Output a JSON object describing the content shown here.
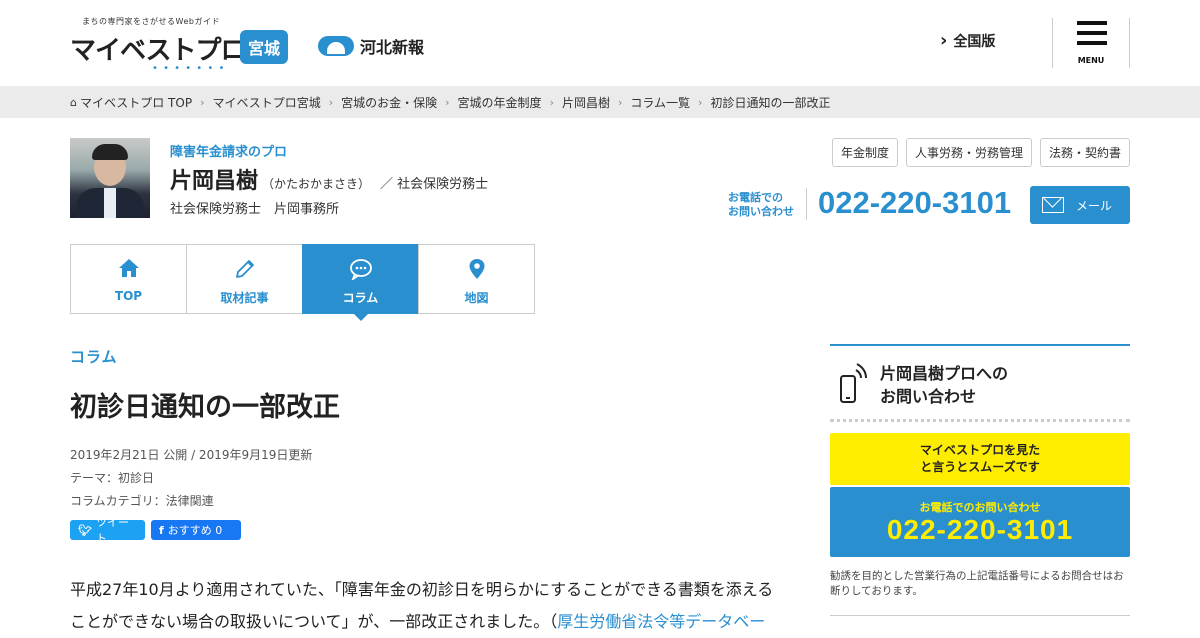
{
  "header": {
    "tagline": "まちの専門家をさがせるWebガイド",
    "brand": "マイベストプロ",
    "brand_dots": "• • • • • • •",
    "region": "宮城",
    "partner": "河北新報",
    "nationwide": "全国版",
    "menu_label": "MENU"
  },
  "breadcrumb": [
    "マイベストプロ TOP",
    "マイベストプロ宮城",
    "宮城のお金・保険",
    "宮城の年金制度",
    "片岡昌樹",
    "コラム一覧",
    "初診日通知の一部改正"
  ],
  "profile": {
    "tag": "障害年金請求のプロ",
    "name": "片岡昌樹",
    "kana": "（かたおかまさき）",
    "role": "／ 社会保険労務士",
    "office": "社会保険労務士　片岡事務所",
    "categories": [
      "年金制度",
      "人事労務・労務管理",
      "法務・契約書"
    ],
    "phone_label_1": "お電話での",
    "phone_label_2": "お問い合わせ",
    "phone": "022-220-3101",
    "mail_label": "メール"
  },
  "tabs": [
    {
      "label": "TOP",
      "icon": "home-icon",
      "active": false
    },
    {
      "label": "取材記事",
      "icon": "pencil-icon",
      "active": false
    },
    {
      "label": "コラム",
      "icon": "chat-icon",
      "active": true
    },
    {
      "label": "地図",
      "icon": "map-pin-icon",
      "active": false
    }
  ],
  "article": {
    "section": "コラム",
    "title": "初診日通知の一部改正",
    "dates": "2019年2月21日 公開 / 2019年9月19日更新",
    "theme": "テーマ：初診日",
    "category": "コラムカテゴリ：法律関連",
    "tweet_label": "ツイート",
    "fb_label": "おすすめ 0",
    "body_1": "平成27年10月より適用されていた、「障害年金の初診日を明らかにすることができる書類を添える",
    "body_2": "ことができない場合の取扱いについて」が、一部改正されました。（",
    "body_link": "厚生労働省法令等データベー"
  },
  "sidebar": {
    "title_1": "片岡昌樹プロへの",
    "title_2": "お問い合わせ",
    "yellow_1": "マイベストプロを見た",
    "yellow_2": "と言うとスムーズです",
    "blue_sub": "お電話でのお問い合わせ",
    "blue_phone": "022-220-3101",
    "note": "勧誘を目的とした営業行為の上記電話番号によるお問合せはお断りしております。"
  },
  "colors": {
    "accent": "#2a8fcf",
    "highlight": "#ffed00",
    "twitter": "#1da1f2",
    "facebook": "#1877f2"
  }
}
